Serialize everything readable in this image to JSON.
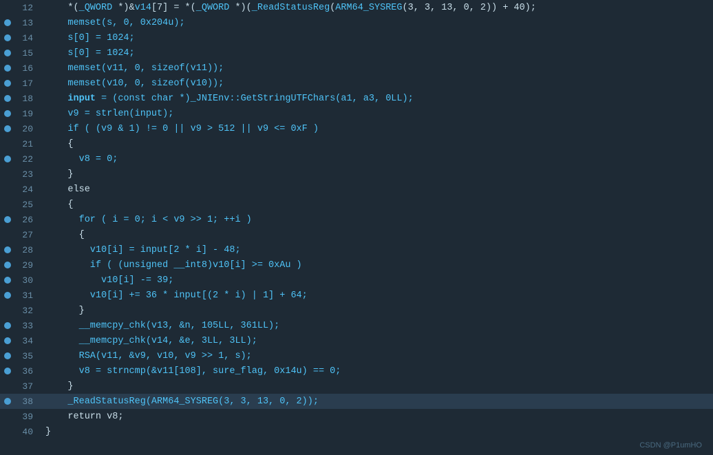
{
  "lines": [
    {
      "num": 12,
      "dot": false,
      "highlighted": false,
      "tokens": [
        {
          "t": "    *(",
          "c": "white"
        },
        {
          "t": "_QWORD",
          "c": "blue"
        },
        {
          "t": " *)&",
          "c": "white"
        },
        {
          "t": "v14",
          "c": "blue"
        },
        {
          "t": "[7] = *(",
          "c": "white"
        },
        {
          "t": "_QWORD",
          "c": "blue"
        },
        {
          "t": " *)(",
          "c": "white"
        },
        {
          "t": "_ReadStatusReg",
          "c": "blue"
        },
        {
          "t": "(",
          "c": "white"
        },
        {
          "t": "ARM64_SYSREG",
          "c": "blue"
        },
        {
          "t": "(3, 3, 13, 0, 2)) + 40);",
          "c": "white"
        }
      ]
    },
    {
      "num": 13,
      "dot": true,
      "highlighted": false,
      "tokens": [
        {
          "t": "    memset(s, 0, 0x204u);",
          "c": "blue"
        }
      ]
    },
    {
      "num": 14,
      "dot": true,
      "highlighted": false,
      "tokens": [
        {
          "t": "    memset(s, 0, 0x204u);",
          "c": "blue"
        }
      ]
    },
    {
      "num": 15,
      "dot": true,
      "highlighted": false,
      "tokens": [
        {
          "t": "    s[0] = 1024;",
          "c": "blue"
        }
      ]
    },
    {
      "num": 16,
      "dot": true,
      "highlighted": false,
      "tokens": [
        {
          "t": "    memset(v11, 0, sizeof(v11));",
          "c": "blue"
        }
      ]
    },
    {
      "num": 17,
      "dot": true,
      "highlighted": false,
      "tokens": [
        {
          "t": "    memset(v10, 0, sizeof(v10));",
          "c": "blue"
        }
      ]
    },
    {
      "num": 18,
      "dot": true,
      "highlighted": false,
      "tokens": [
        {
          "t": "    input",
          "c": "blue",
          "bold": true
        },
        {
          "t": " = (const char *)_JNIEnv::GetStringUTFChars(a1, a3, 0LL);",
          "c": "blue"
        }
      ]
    },
    {
      "num": 19,
      "dot": true,
      "highlighted": false,
      "tokens": [
        {
          "t": "    v9 = strlen(input);",
          "c": "blue"
        }
      ]
    },
    {
      "num": 20,
      "dot": true,
      "highlighted": false,
      "tokens": [
        {
          "t": "    if ( (v9 & 1) != 0 || v9 > 512 || v9 <= 0xF )",
          "c": "blue"
        }
      ]
    },
    {
      "num": 21,
      "dot": false,
      "highlighted": false,
      "tokens": [
        {
          "t": "    {",
          "c": "white"
        }
      ]
    },
    {
      "num": 22,
      "dot": true,
      "highlighted": false,
      "tokens": [
        {
          "t": "      v8 = 0;",
          "c": "blue"
        }
      ]
    },
    {
      "num": 23,
      "dot": false,
      "highlighted": false,
      "tokens": [
        {
          "t": "    }",
          "c": "white"
        }
      ]
    },
    {
      "num": 24,
      "dot": false,
      "highlighted": false,
      "tokens": [
        {
          "t": "    else",
          "c": "white"
        }
      ]
    },
    {
      "num": 25,
      "dot": false,
      "highlighted": false,
      "tokens": [
        {
          "t": "    {",
          "c": "white"
        }
      ]
    },
    {
      "num": 26,
      "dot": true,
      "highlighted": false,
      "tokens": [
        {
          "t": "      for ( i = 0; i < v9 >> 1; ++i )",
          "c": "blue"
        }
      ]
    },
    {
      "num": 27,
      "dot": false,
      "highlighted": false,
      "tokens": [
        {
          "t": "      {",
          "c": "white"
        }
      ]
    },
    {
      "num": 28,
      "dot": true,
      "highlighted": false,
      "tokens": [
        {
          "t": "        v10[i] = input[2 * i] - 48;",
          "c": "blue"
        }
      ]
    },
    {
      "num": 29,
      "dot": true,
      "highlighted": false,
      "tokens": [
        {
          "t": "        if ( (unsigned __int8)v10[i] >= 0xAu )",
          "c": "blue"
        }
      ]
    },
    {
      "num": 30,
      "dot": true,
      "highlighted": false,
      "tokens": [
        {
          "t": "          v10[i] -= 39;",
          "c": "blue"
        }
      ]
    },
    {
      "num": 31,
      "dot": true,
      "highlighted": false,
      "tokens": [
        {
          "t": "        v10[i] += 36 * input[(2 * i) | 1] + 64;",
          "c": "blue"
        }
      ]
    },
    {
      "num": 32,
      "dot": false,
      "highlighted": false,
      "tokens": [
        {
          "t": "      }",
          "c": "white"
        }
      ]
    },
    {
      "num": 33,
      "dot": true,
      "highlighted": false,
      "tokens": [
        {
          "t": "      __memcpy_chk(v13, &n, 105LL, 361LL);",
          "c": "blue"
        }
      ]
    },
    {
      "num": 34,
      "dot": true,
      "highlighted": false,
      "tokens": [
        {
          "t": "      __memcpy_chk(v14, &e, 3LL, 3LL);",
          "c": "blue"
        }
      ]
    },
    {
      "num": 35,
      "dot": true,
      "highlighted": false,
      "tokens": [
        {
          "t": "      RSA(v11, &v9, v10, v9 >> 1, s);",
          "c": "blue"
        }
      ]
    },
    {
      "num": 36,
      "dot": true,
      "highlighted": false,
      "tokens": [
        {
          "t": "      v8 = strncmp(&v11[108], sure_flag, 0x14u) == 0;",
          "c": "blue"
        }
      ]
    },
    {
      "num": 37,
      "dot": false,
      "highlighted": false,
      "tokens": [
        {
          "t": "    }",
          "c": "white"
        }
      ]
    },
    {
      "num": 38,
      "dot": true,
      "highlighted": true,
      "tokens": [
        {
          "t": "    _ReadStatusReg(ARM64_SYSREG(3, 3, 13, 0, 2));",
          "c": "blue"
        }
      ]
    },
    {
      "num": 39,
      "dot": false,
      "highlighted": false,
      "tokens": [
        {
          "t": "    return v8;",
          "c": "white"
        }
      ]
    },
    {
      "num": 40,
      "dot": false,
      "highlighted": false,
      "tokens": [
        {
          "t": "}",
          "c": "white"
        }
      ]
    }
  ],
  "watermark": "CSDN @P1umHO"
}
